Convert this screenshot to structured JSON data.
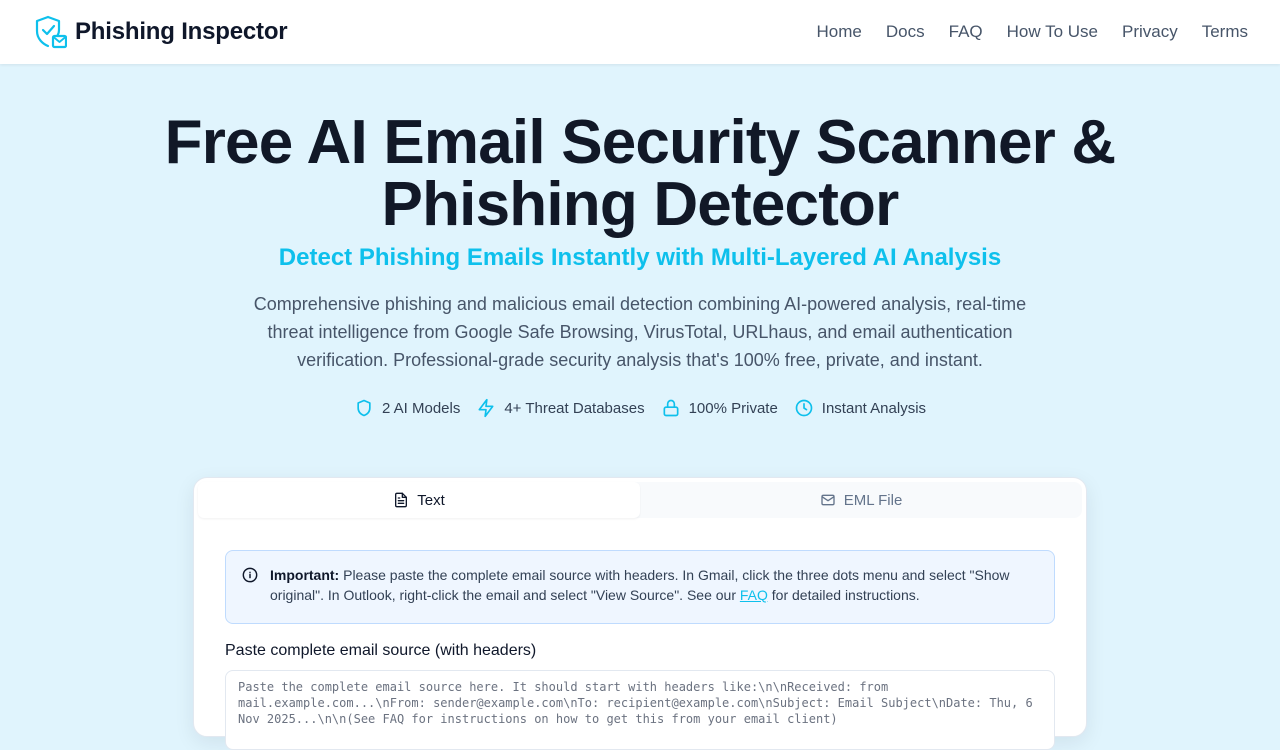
{
  "brand": {
    "name": "Phishing Inspector",
    "accent": "#0ec0ec"
  },
  "nav": {
    "links": [
      {
        "label": "Home"
      },
      {
        "label": "Docs"
      },
      {
        "label": "FAQ"
      },
      {
        "label": "How To Use"
      },
      {
        "label": "Privacy"
      },
      {
        "label": "Terms"
      }
    ]
  },
  "hero": {
    "title": "Free AI Email Security Scanner & Phishing Detector",
    "subtitle": "Detect Phishing Emails Instantly with Multi-Layered AI Analysis",
    "description": "Comprehensive phishing and malicious email detection combining AI-powered analysis, real-time threat intelligence from Google Safe Browsing, VirusTotal, URLhaus, and email authentication verification. Professional-grade security analysis that's 100% free, private, and instant."
  },
  "features": [
    {
      "icon": "shield-icon",
      "label": "2 AI Models"
    },
    {
      "icon": "lightning-icon",
      "label": "4+ Threat Databases"
    },
    {
      "icon": "lock-icon",
      "label": "100% Private"
    },
    {
      "icon": "clock-icon",
      "label": "Instant Analysis"
    }
  ],
  "scanner": {
    "tabs": [
      {
        "icon": "document-icon",
        "label": "Text",
        "active": true
      },
      {
        "icon": "mail-icon",
        "label": "EML File",
        "active": false
      }
    ],
    "notice": {
      "strong": "Important:",
      "text_before_link": " Please paste the complete email source with headers. In Gmail, click the three dots menu and select \"Show original\". In Outlook, right-click the email and select \"View Source\". See our ",
      "link": "FAQ",
      "text_after_link": " for detailed instructions."
    },
    "input_label": "Paste complete email source (with headers)",
    "input_placeholder": "Paste the complete email source here. It should start with headers like:\\n\\nReceived: from mail.example.com...\\nFrom: sender@example.com\\nTo: recipient@example.com\\nSubject: Email Subject\\nDate: Thu, 6 Nov 2025...\\n\\n(See FAQ for instructions on how to get this from your email client)"
  }
}
